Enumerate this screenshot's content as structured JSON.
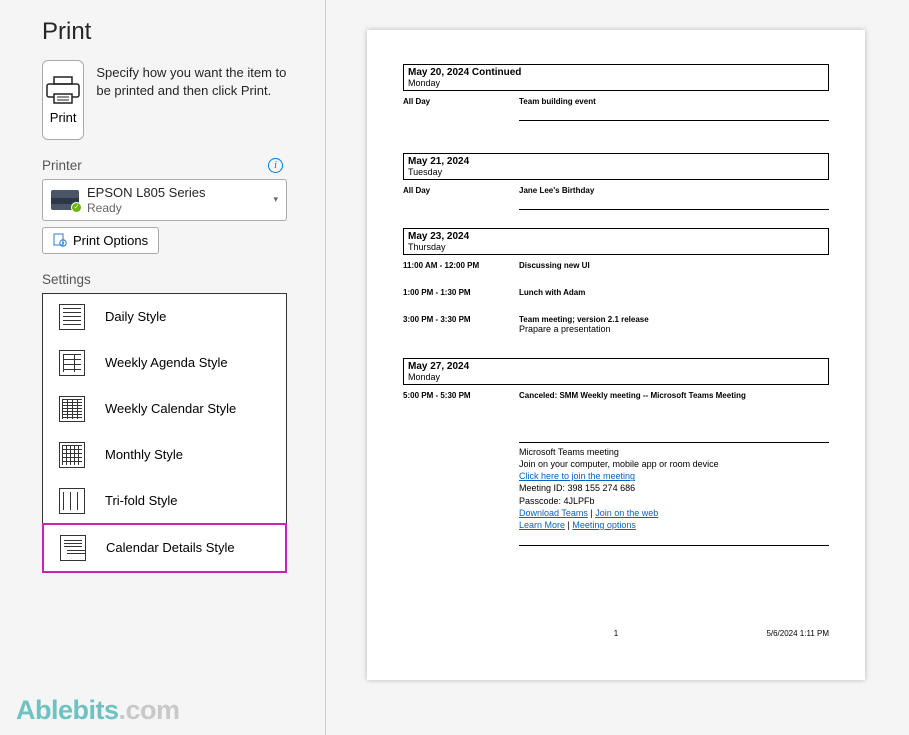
{
  "header": {
    "title": "Print"
  },
  "print": {
    "button_label": "Print",
    "description": "Specify how you want the item to be printed and then click Print."
  },
  "printer": {
    "section_label": "Printer",
    "name": "EPSON L805 Series",
    "status": "Ready",
    "options_label": "Print Options"
  },
  "settings": {
    "section_label": "Settings",
    "styles": [
      {
        "label": "Daily Style"
      },
      {
        "label": "Weekly Agenda Style"
      },
      {
        "label": "Weekly Calendar Style"
      },
      {
        "label": "Monthly Style"
      },
      {
        "label": "Tri-fold Style"
      },
      {
        "label": "Calendar Details Style"
      }
    ],
    "selected_index": 5
  },
  "preview": {
    "days": [
      {
        "date": "May 20, 2024 Continued",
        "dow": "Monday",
        "events": [
          {
            "time": "All Day",
            "title": "Team building event",
            "allday": true
          }
        ]
      },
      {
        "date": "May 21, 2024",
        "dow": "Tuesday",
        "events": [
          {
            "time": "All Day",
            "title": "Jane Lee's Birthday",
            "allday": true
          }
        ]
      },
      {
        "date": "May 23, 2024",
        "dow": "Thursday",
        "events": [
          {
            "time": "11:00 AM - 12:00 PM",
            "title": "Discussing new UI"
          },
          {
            "time": "1:00 PM - 1:30 PM",
            "title": "Lunch with Adam"
          },
          {
            "time": "3:00 PM - 3:30 PM",
            "title": "Team meeting; version 2.1 release",
            "note": "Prapare a presentation"
          }
        ]
      },
      {
        "date": "May 27, 2024",
        "dow": "Monday",
        "events": [
          {
            "time": "5:00 PM - 5:30 PM",
            "title": "Canceled: SMM Weekly meeting -- Microsoft Teams Meeting"
          }
        ]
      }
    ],
    "teams": {
      "heading": "Microsoft Teams meeting",
      "subtitle": "Join on your computer, mobile app or room device",
      "join_link": "Click here to join the meeting",
      "meeting_id": "Meeting ID: 398 155 274 686",
      "passcode": "Passcode: 4JLPFb",
      "download": "Download Teams",
      "sep": " | ",
      "joinweb": "Join on the web",
      "learnmore": "Learn More",
      "options": "Meeting options"
    },
    "footer": {
      "page": "1",
      "timestamp": "5/6/2024 1:11 PM"
    }
  },
  "watermark": {
    "part1": "Ablebits",
    "part2": ".com"
  }
}
